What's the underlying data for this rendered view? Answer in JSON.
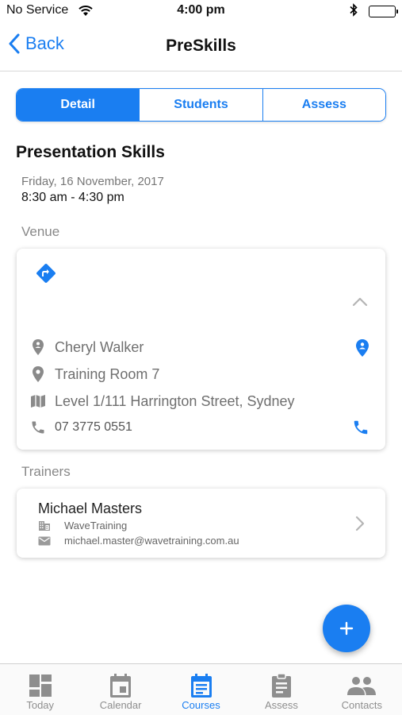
{
  "status_bar": {
    "carrier": "No Service",
    "time": "4:00 pm",
    "icons": [
      "wifi-icon",
      "bluetooth-icon",
      "battery-icon"
    ]
  },
  "nav": {
    "back_label": "Back",
    "title": "PreSkills"
  },
  "segments": [
    {
      "label": "Detail",
      "active": true
    },
    {
      "label": "Students",
      "active": false
    },
    {
      "label": "Assess",
      "active": false
    }
  ],
  "course": {
    "title": "Presentation Skills",
    "date": "Friday, 16 November, 2017",
    "time": "8:30 am - 4:30 pm"
  },
  "venue": {
    "section_label": "Venue",
    "contact": "Cheryl Walker",
    "room": "Training Room 7",
    "address": "Level 1/111 Harrington Street, Sydney",
    "phone": "07 3775  0551"
  },
  "trainers": {
    "section_label": "Trainers",
    "items": [
      {
        "name": "Michael Masters",
        "company": "WaveTraining",
        "email": "michael.master@wavetraining.com.au"
      }
    ]
  },
  "tabs": [
    {
      "label": "Today",
      "icon": "dashboard-icon",
      "active": false
    },
    {
      "label": "Calendar",
      "icon": "calendar-icon",
      "active": false
    },
    {
      "label": "Courses",
      "icon": "courses-icon",
      "active": true
    },
    {
      "label": "Assess",
      "icon": "clipboard-icon",
      "active": false
    },
    {
      "label": "Contacts",
      "icon": "people-icon",
      "active": false
    }
  ],
  "colors": {
    "accent": "#1a7ef1",
    "muted_text": "#888888",
    "icon_gray": "#8a8a8a"
  }
}
